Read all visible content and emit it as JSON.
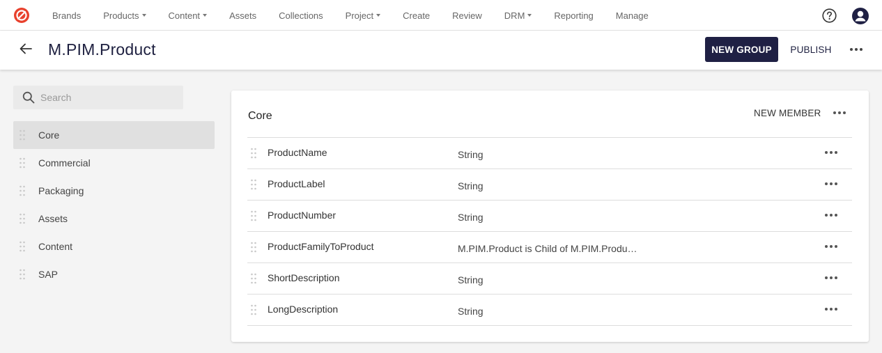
{
  "nav": {
    "items": [
      {
        "label": "Brands",
        "dropdown": false
      },
      {
        "label": "Products",
        "dropdown": true
      },
      {
        "label": "Content",
        "dropdown": true
      },
      {
        "label": "Assets",
        "dropdown": false
      },
      {
        "label": "Collections",
        "dropdown": false
      },
      {
        "label": "Project",
        "dropdown": true
      },
      {
        "label": "Create",
        "dropdown": false
      },
      {
        "label": "Review",
        "dropdown": false
      },
      {
        "label": "DRM",
        "dropdown": true
      },
      {
        "label": "Reporting",
        "dropdown": false
      },
      {
        "label": "Manage",
        "dropdown": false
      }
    ],
    "icons": [
      "logo-icon",
      "help-icon",
      "avatar-icon"
    ]
  },
  "header": {
    "title": "M.PIM.Product",
    "new_group_label": "NEW GROUP",
    "publish_label": "PUBLISH"
  },
  "sidebar": {
    "search_placeholder": "Search",
    "items": [
      {
        "label": "Core",
        "active": true
      },
      {
        "label": "Commercial",
        "active": false
      },
      {
        "label": "Packaging",
        "active": false
      },
      {
        "label": "Assets",
        "active": false
      },
      {
        "label": "Content",
        "active": false
      },
      {
        "label": "SAP",
        "active": false
      }
    ]
  },
  "group": {
    "title": "Core",
    "new_member_label": "NEW MEMBER",
    "members": [
      {
        "name": "ProductName",
        "type": "String"
      },
      {
        "name": "ProductLabel",
        "type": "String"
      },
      {
        "name": "ProductNumber",
        "type": "String"
      },
      {
        "name": "ProductFamilyToProduct",
        "type": "M.PIM.Product is Child of M.PIM.Produ…"
      },
      {
        "name": "ShortDescription",
        "type": "String"
      },
      {
        "name": "LongDescription",
        "type": "String"
      }
    ]
  },
  "colors": {
    "brand_red": "#e8412d",
    "primary_button": "#1f2044",
    "title_text": "#1e2040",
    "active_item_bg": "#e0e0e0"
  }
}
